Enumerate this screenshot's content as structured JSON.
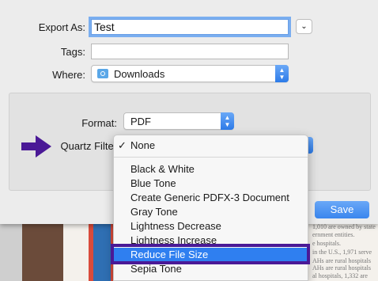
{
  "background_doc": {
    "lines": [
      "1,010 are owned by state",
      "ernment entities.",
      "e hospitals.",
      "in the U.S., 1,971 serve",
      "AHs are rural hospitals",
      "AHs are rural hospitals",
      "al hospitals, 1,332 are",
      "ostitals."
    ]
  },
  "dialog": {
    "export_as": {
      "label": "Export As:",
      "value": "Test"
    },
    "tags": {
      "label": "Tags:",
      "value": ""
    },
    "where": {
      "label": "Where:",
      "value": "Downloads"
    },
    "format": {
      "label": "Format:",
      "value": "PDF"
    },
    "quartz_filter": {
      "label": "Quartz Filter"
    },
    "save_label": "Save"
  },
  "menu": {
    "top_item": {
      "label": "None",
      "checked": true,
      "check": "✓"
    },
    "items": [
      "Black & White",
      "Blue Tone",
      "Create Generic PDFX-3 Document",
      "Gray Tone",
      "Lightness Decrease",
      "Lightness Increase",
      "Reduce File Size",
      "Sepia Tone"
    ],
    "highlighted_index": 6
  },
  "colors": {
    "accent": "#2f7ff0",
    "annotation": "#4a1996"
  },
  "icons": {
    "folder": "folder-icon",
    "disclosure": "chevron-down-icon",
    "popup_stepper": "up-down-chevron-icon",
    "annotation_arrow": "arrow-right-icon"
  }
}
